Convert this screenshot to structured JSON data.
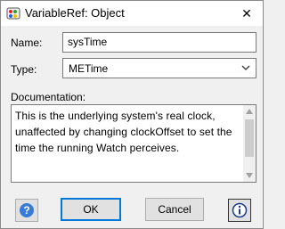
{
  "window": {
    "title": "VariableRef: Object",
    "close_glyph": "✕",
    "app_icon": "palette-icon"
  },
  "form": {
    "name_label": "Name:",
    "name_value": "sysTime",
    "type_label": "Type:",
    "type_value": "METime",
    "doc_label": "Documentation:",
    "doc_text": "This is the underlying system's real clock,\nunaffected by changing clockOffset to set the\ntime the running Watch perceives."
  },
  "buttons": {
    "help_icon": "help-icon",
    "ok_label": "OK",
    "cancel_label": "Cancel",
    "info_icon": "info-icon"
  },
  "colors": {
    "accent": "#0078d7",
    "help_blue": "#3a7bd5"
  }
}
